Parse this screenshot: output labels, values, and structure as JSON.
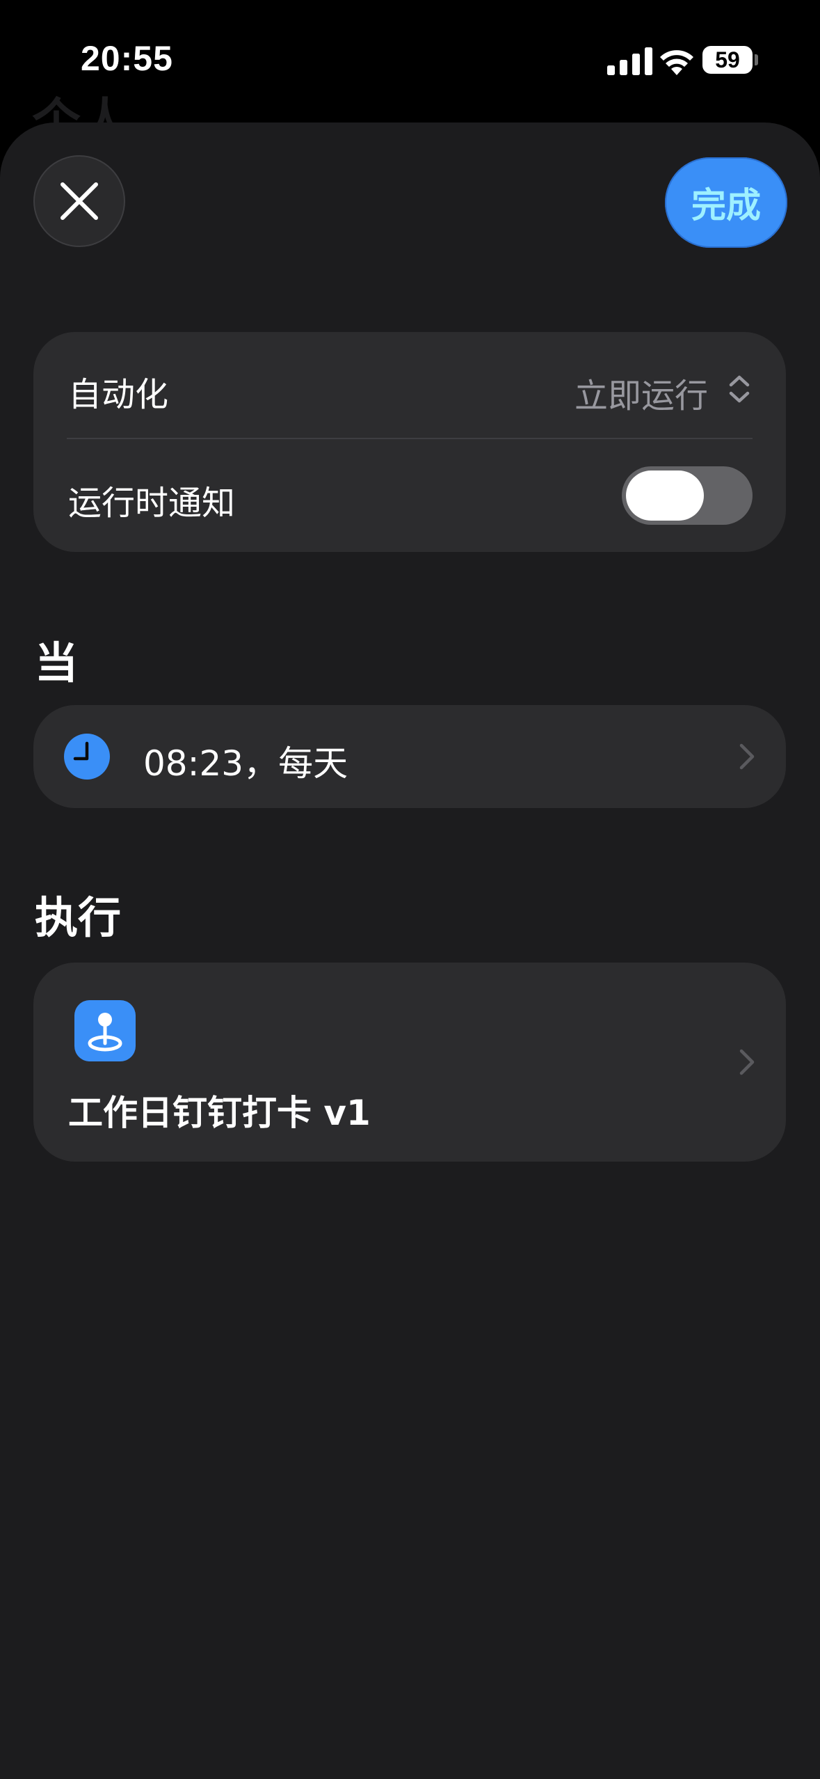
{
  "status_bar": {
    "time": "20:55",
    "battery": "59"
  },
  "header": {
    "peek_title": "个人",
    "done_label": "完成"
  },
  "settings": {
    "automation_label": "自动化",
    "automation_value": "立即运行",
    "notify_label": "运行时通知",
    "notify_on": false
  },
  "when_section": {
    "title": "当",
    "trigger_text": "08:23，每天"
  },
  "do_section": {
    "title": "执行",
    "action_name": "工作日钉钉打卡 v1"
  },
  "colors": {
    "accent": "#3a8ff7",
    "sheet": "#1c1c1e",
    "card": "#2c2c2e",
    "secondary_text": "#98989f"
  },
  "icons": {
    "close": "close-icon",
    "updown": "chevron-updown-icon",
    "clock": "clock-icon",
    "shortcut": "location-pin-icon",
    "disclosure": "chevron-right-icon"
  }
}
